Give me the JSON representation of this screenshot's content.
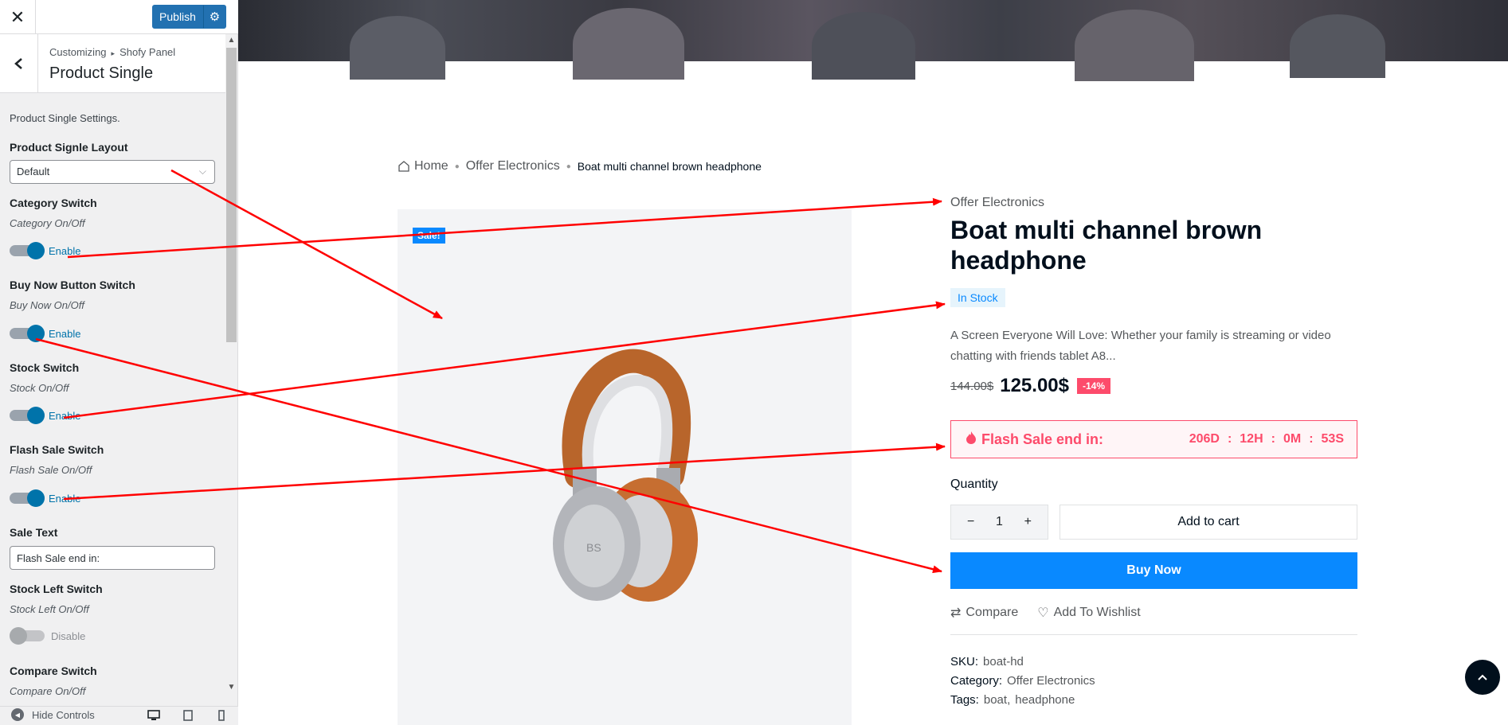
{
  "customizer": {
    "close_icon": "close-icon",
    "publish_label": "Publish",
    "breadcrumb_root": "Customizing",
    "breadcrumb_parent": "Shofy Panel",
    "panel_title": "Product Single",
    "description": "Product Single Settings.",
    "layout": {
      "title": "Product Signle Layout",
      "value": "Default"
    },
    "controls": [
      {
        "title": "Category Switch",
        "subtitle": "Category On/Off",
        "state": "Enable"
      },
      {
        "title": "Buy Now Button Switch",
        "subtitle": "Buy Now On/Off",
        "state": "Enable"
      },
      {
        "title": "Stock Switch",
        "subtitle": "Stock On/Off",
        "state": "Enable"
      },
      {
        "title": "Flash Sale Switch",
        "subtitle": "Flash Sale On/Off",
        "state": "Enable"
      }
    ],
    "sale_text": {
      "title": "Sale Text",
      "value": "Flash Sale end in:"
    },
    "stock_left": {
      "title": "Stock Left Switch",
      "subtitle": "Stock Left On/Off",
      "state": "Disable"
    },
    "compare": {
      "title": "Compare Switch",
      "subtitle": "Compare On/Off"
    },
    "footer": {
      "hide_controls": "Hide Controls"
    }
  },
  "product": {
    "breadcrumb": [
      "Home",
      "Offer Electronics",
      "Boat multi channel brown headphone"
    ],
    "sale_badge": "Sale!",
    "category": "Offer Electronics",
    "title": "Boat multi channel brown headphone",
    "stock": "In Stock",
    "description": "A Screen Everyone Will Love: Whether your family is streaming or video chatting with friends tablet A8...",
    "old_price": "144.00$",
    "price": "125.00$",
    "discount": "-14%",
    "flash_label": "Flash Sale end in:",
    "countdown": [
      "206D",
      "12H",
      "0M",
      "53S"
    ],
    "quantity_label": "Quantity",
    "quantity": "1",
    "add_to_cart": "Add to cart",
    "buy_now": "Buy Now",
    "compare": "Compare",
    "wishlist": "Add To Wishlist",
    "sku_label": "SKU:",
    "sku": "boat-hd",
    "category_label": "Category:",
    "tags_label": "Tags:",
    "tags": [
      "boat",
      "headphone"
    ]
  },
  "colors": {
    "wp_blue": "#2271b1",
    "toggle_on": "#0073aa",
    "shop_blue": "#0989ff",
    "flash_pink": "#fd4b6b",
    "annotation_red": "#ff0000"
  }
}
